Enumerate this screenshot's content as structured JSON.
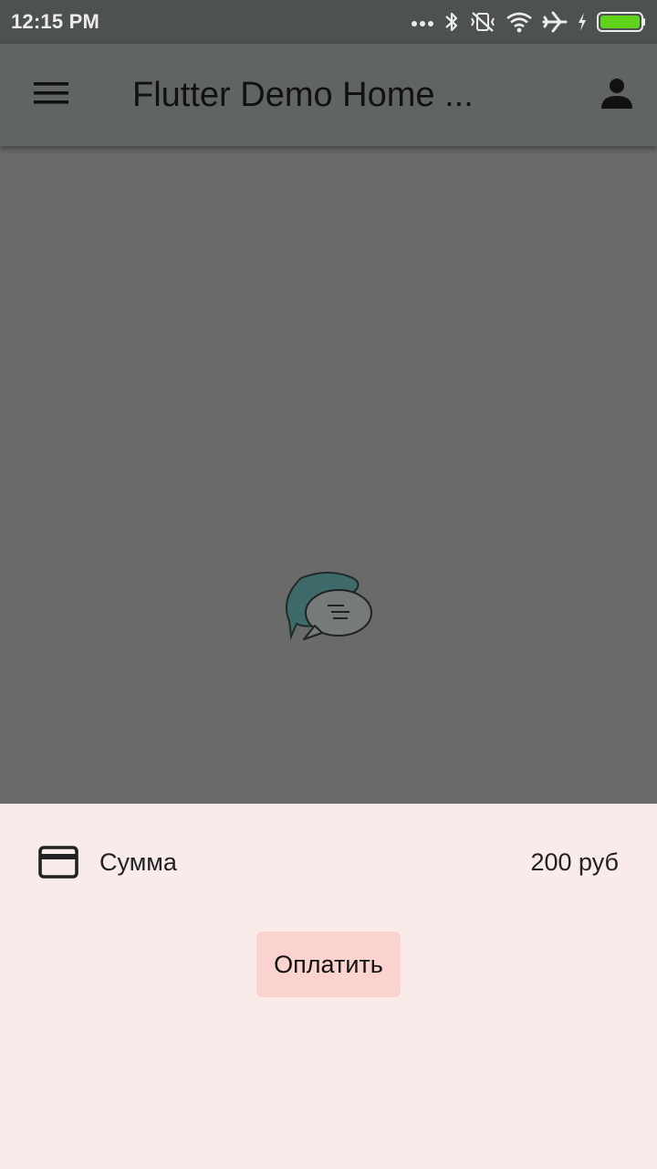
{
  "status_bar": {
    "time": "12:15 PM",
    "icons": [
      "more-dots-icon",
      "bluetooth-icon",
      "vibrate-off-icon",
      "wifi-icon",
      "airplane-icon",
      "charging-icon",
      "battery-icon"
    ],
    "battery_color": "#5fd31b"
  },
  "app_bar": {
    "menu_icon": "menu-icon",
    "title": "Flutter Demo Home ...",
    "account_icon": "account-icon"
  },
  "content": {
    "illustration_icon": "chat-bubbles-icon"
  },
  "bottom_sheet": {
    "card_icon": "credit-card-icon",
    "sum_label": "Сумма",
    "sum_value": "200 руб",
    "pay_label": "Оплатить",
    "pay_button_color": "#fad3ce",
    "background_color": "#f8ebea"
  }
}
